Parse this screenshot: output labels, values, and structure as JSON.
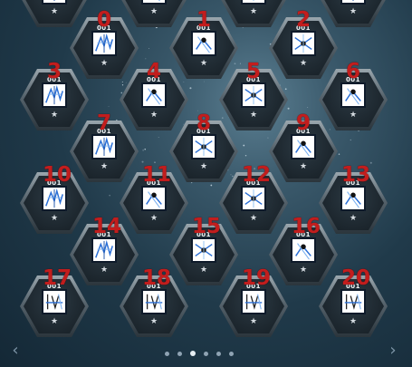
{
  "tiles": [
    {
      "label": "",
      "code": "",
      "star": "★",
      "kind": 0
    },
    {
      "label": "",
      "code": "",
      "star": "★",
      "kind": 1
    },
    {
      "label": "",
      "code": "",
      "star": "★",
      "kind": 2
    },
    {
      "label": "",
      "code": "",
      "star": "★",
      "kind": 0
    },
    {
      "label": "0",
      "code": "001",
      "star": "★",
      "kind": 0
    },
    {
      "label": "1",
      "code": "001",
      "star": "★",
      "kind": 1
    },
    {
      "label": "2",
      "code": "001",
      "star": "★",
      "kind": 2
    },
    {
      "label": "3",
      "code": "001",
      "star": "★",
      "kind": 0
    },
    {
      "label": "4",
      "code": "001",
      "star": "★",
      "kind": 1
    },
    {
      "label": "5",
      "code": "001",
      "star": "★",
      "kind": 2
    },
    {
      "label": "6",
      "code": "001",
      "star": "★",
      "kind": 1
    },
    {
      "label": "7",
      "code": "001",
      "star": "★",
      "kind": 0
    },
    {
      "label": "8",
      "code": "001",
      "star": "★",
      "kind": 2
    },
    {
      "label": "9",
      "code": "001",
      "star": "★",
      "kind": 1
    },
    {
      "label": "10",
      "code": "001",
      "star": "★",
      "kind": 0
    },
    {
      "label": "11",
      "code": "001",
      "star": "★",
      "kind": 1
    },
    {
      "label": "12",
      "code": "001",
      "star": "★",
      "kind": 2
    },
    {
      "label": "13",
      "code": "001",
      "star": "★",
      "kind": 1
    },
    {
      "label": "14",
      "code": "001",
      "star": "★",
      "kind": 0
    },
    {
      "label": "15",
      "code": "001",
      "star": "★",
      "kind": 2
    },
    {
      "label": "16",
      "code": "001",
      "star": "★",
      "kind": 1
    },
    {
      "label": "17",
      "code": "001",
      "star": "★",
      "kind": 3
    },
    {
      "label": "18",
      "code": "001",
      "star": "★",
      "kind": 3
    },
    {
      "label": "19",
      "code": "001",
      "star": "★",
      "kind": 3
    },
    {
      "label": "20",
      "code": "001",
      "star": "★",
      "kind": 3
    }
  ],
  "icons": {
    "tile_art": "blue-ice-sketch-card-icon",
    "rarity": "star-icon",
    "prev": "chevron-left-icon",
    "next": "chevron-right-icon"
  },
  "nav": {
    "prev": "‹",
    "next": "›"
  },
  "pager": {
    "count": 6,
    "active": 2
  },
  "colors": {
    "label": "#c21d1d",
    "frame": "#9aa6ad",
    "background": "#203a4a",
    "art_blue": "#2a6fd6"
  }
}
